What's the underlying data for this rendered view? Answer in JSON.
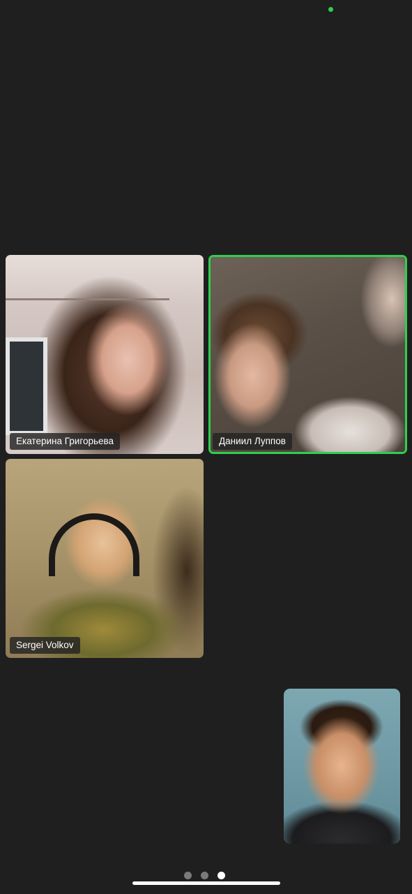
{
  "status": {
    "indicator_color": "#2fcf4e"
  },
  "colors": {
    "background": "#1f1f1f",
    "active_speaker_border": "#2fcf4e"
  },
  "participants": [
    {
      "name": "Екатерина Григорьева",
      "active_speaker": false
    },
    {
      "name": "Даниил Луппов",
      "active_speaker": true
    },
    {
      "name": "Sergei Volkov",
      "active_speaker": false
    }
  ],
  "self_view": {
    "label": ""
  },
  "pagination": {
    "total_pages": 3,
    "current_page": 3
  }
}
